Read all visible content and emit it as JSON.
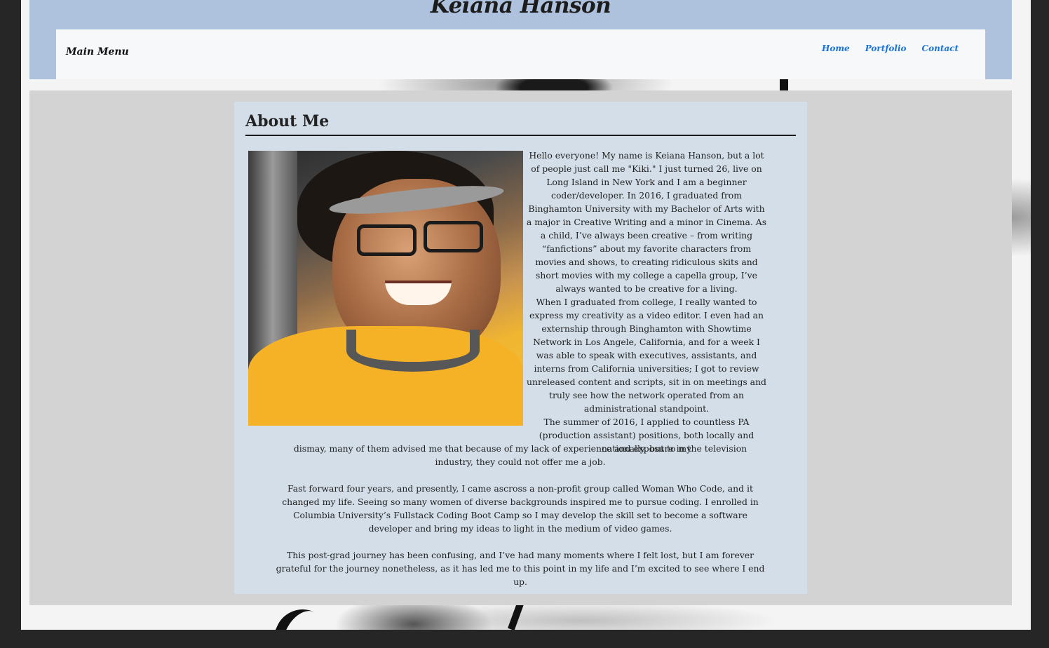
{
  "site": {
    "title": "Keiana Hanson"
  },
  "nav": {
    "menu_label": "Main Menu",
    "links": [
      "Home",
      "Portfolio",
      "Contact"
    ]
  },
  "about": {
    "heading": "About Me",
    "photo_alt": "Portrait of Keiana smiling in a yellow shirt",
    "paragraphs": [
      "Hello everyone! My name is Keiana Hanson, but a lot of people just call me \"Kiki.\" I just turned 26, live on Long Island in New York and I am a beginner coder/developer. In 2016, I graduated from Binghamton University with my Bachelor of Arts with a major in Creative Writing and a minor in Cinema. As a child, I’ve always been creative – from writing “fanfictions” about my favorite characters from movies and shows, to creating ridiculous skits and short movies with my college a capella group, I’ve always wanted to be creative for a living.",
      "When I graduated from college, I really wanted to express my creativity as a video editor. I even had an externship through Binghamton with Showtime Network in Los Angele, California, and for a week I was able to speak with executives, assistants, and interns from California universities; I got to review unreleased content and scripts, sit in on meetings and truly see how the network operated from an administrational standpoint.",
      "The summer of 2016, I applied to countless PA (production assistant) positions, both locally and nationally, but to my",
      "dismay, many of them advised me that because of my lack of experience and exposure in the television industry, they could not offer me a job.",
      "Fast forward four years, and presently, I came ascross a non-profit group called Woman Who Code, and it changed my life. Seeing so many women of diverse backgrounds inspired me to pursue coding. I enrolled in Columbia University’s Fullstack Coding Boot Camp so I may develop the skill set to become a software developer and bring my ideas to light in the medium of video games.",
      "This post-grad journey has been confusing, and I’ve had many moments where I felt lost, but I am forever grateful for the journey nonetheless, as it has led me to this point in my life and I’m excited to see where I end up."
    ]
  },
  "colors": {
    "header_bg": "#aec2dd",
    "nav_bg": "#f7f8fa",
    "link": "#1a73d9",
    "content_bg": "#d3d3d3",
    "card_bg": "#d3dee8"
  }
}
